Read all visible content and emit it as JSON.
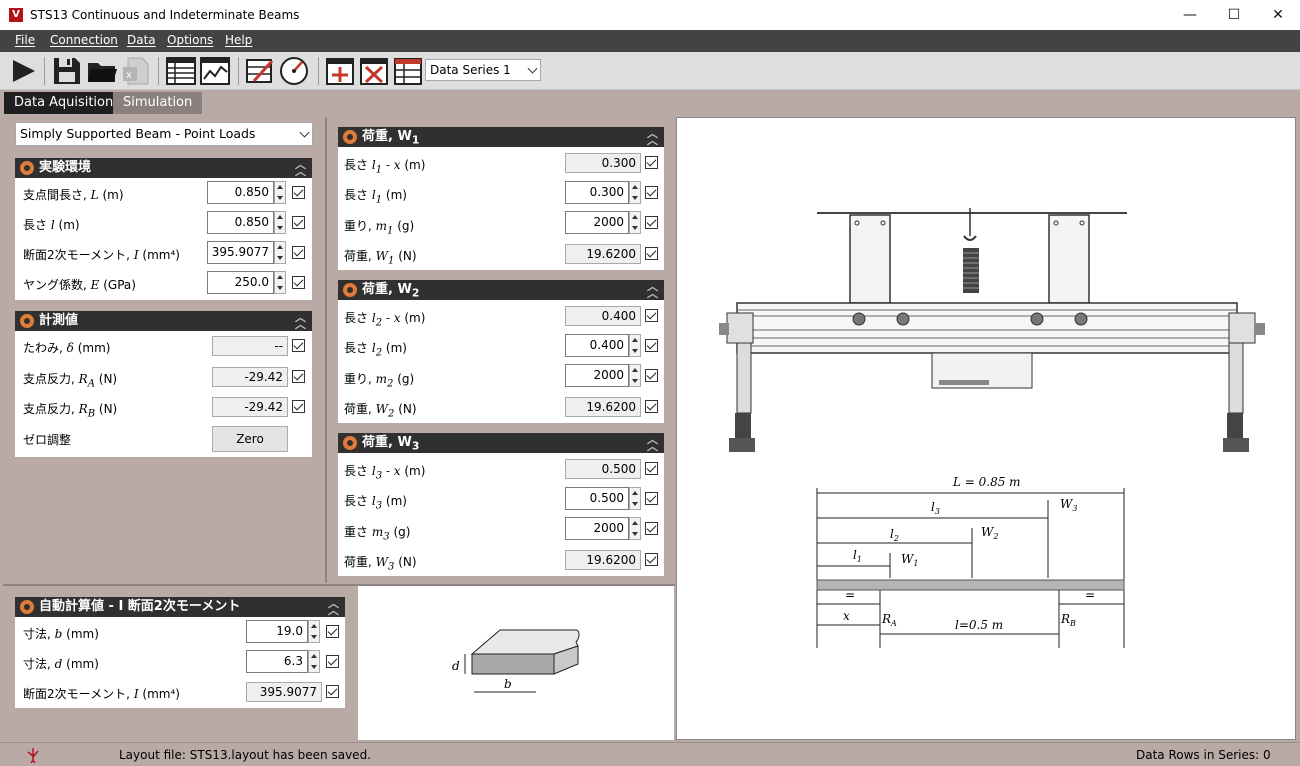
{
  "app": {
    "title": "STS13 Continuous and Indeterminate Beams",
    "logo_letter": "V",
    "window_buttons": {
      "minimize": "—",
      "maximize": "☐",
      "close": "✕"
    }
  },
  "menu": [
    "File",
    "Connection",
    "Data",
    "Options",
    "Help"
  ],
  "toolbar": {
    "series_value": "Data Series 1"
  },
  "tabs": [
    {
      "label": "Data Aquisition",
      "active": true
    },
    {
      "label": "Simulation",
      "active": false
    }
  ],
  "experiment_select": "Simply Supported Beam - Point Loads",
  "env_panel": {
    "title": "実験環境",
    "rows": [
      {
        "label": "支点間長さ,",
        "sym": "L",
        "unit": "(m)",
        "value": "0.850"
      },
      {
        "label": "長さ",
        "sym": "l",
        "unit": "(m)",
        "value": "0.850"
      },
      {
        "label": "断面2次モーメント,",
        "sym": "I",
        "unit": "(mm⁴)",
        "value": "395.9077"
      },
      {
        "label": "ヤング係数,",
        "sym": "E",
        "unit": "(GPa)",
        "value": "250.0"
      }
    ]
  },
  "meas_panel": {
    "title": "計測値",
    "rows": [
      {
        "label": "たわみ,",
        "sym": "δ",
        "unit": "(mm)",
        "value": "--"
      },
      {
        "label": "支点反力,",
        "sym": "R",
        "sub": "A",
        "unit": "(N)",
        "value": "-29.42"
      },
      {
        "label": "支点反力,",
        "sym": "R",
        "sub": "B",
        "unit": "(N)",
        "value": "-29.42"
      }
    ],
    "zero_label": "ゼロ調整",
    "zero_button": "Zero"
  },
  "w1_panel": {
    "title": "荷重, W",
    "title_sub": "1",
    "rows": [
      {
        "label": "長さ",
        "sym": "l",
        "sub": "1",
        "extra": " - x",
        "unit": "(m)",
        "value": "0.300",
        "editable": false
      },
      {
        "label": "長さ",
        "sym": "l",
        "sub": "1",
        "extra": "",
        "unit": "(m)",
        "value": "0.300",
        "editable": true
      },
      {
        "label": "重り,",
        "sym": "m",
        "sub": "1",
        "extra": "",
        "unit": "(g)",
        "value": "2000",
        "editable": true
      },
      {
        "label": "荷重,",
        "sym": "W",
        "sub": "1",
        "extra": "",
        "unit": "(N)",
        "value": "19.6200",
        "editable": false
      }
    ]
  },
  "w2_panel": {
    "title": "荷重, W",
    "title_sub": "2",
    "rows": [
      {
        "label": "長さ",
        "sym": "l",
        "sub": "2",
        "extra": " - x",
        "unit": "(m)",
        "value": "0.400",
        "editable": false
      },
      {
        "label": "長さ",
        "sym": "l",
        "sub": "2",
        "extra": "",
        "unit": "(m)",
        "value": "0.400",
        "editable": true
      },
      {
        "label": "重り,",
        "sym": "m",
        "sub": "2",
        "extra": "",
        "unit": "(g)",
        "value": "2000",
        "editable": true
      },
      {
        "label": "荷重,",
        "sym": "W",
        "sub": "2",
        "extra": "",
        "unit": "(N)",
        "value": "19.6200",
        "editable": false
      }
    ]
  },
  "w3_panel": {
    "title": "荷重, W",
    "title_sub": "3",
    "rows": [
      {
        "label": "長さ",
        "sym": "l",
        "sub": "3",
        "extra": " - x",
        "unit": "(m)",
        "value": "0.500",
        "editable": false
      },
      {
        "label": "長さ",
        "sym": "l",
        "sub": "3",
        "extra": "",
        "unit": "(m)",
        "value": "0.500",
        "editable": true
      },
      {
        "label": "重さ",
        "sym": "m",
        "sub": "3",
        "extra": "",
        "unit": "(g)",
        "value": "2000",
        "editable": true
      },
      {
        "label": "荷重,",
        "sym": "W",
        "sub": "3",
        "extra": "",
        "unit": "(N)",
        "value": "19.6200",
        "editable": false
      }
    ]
  },
  "calc_panel": {
    "title": "自動計算値 - I 断面2次モーメント",
    "rows": [
      {
        "label": "寸法,",
        "sym": "b",
        "unit": "(mm)",
        "value": "19.0",
        "editable": true
      },
      {
        "label": "寸法,",
        "sym": "d",
        "unit": "(mm)",
        "value": "6.3",
        "editable": true
      },
      {
        "label": "断面2次モーメント,",
        "sym": "I",
        "unit": "(mm⁴)",
        "value": "395.9077",
        "editable": false
      }
    ],
    "section_labels": {
      "d": "d",
      "b": "b"
    }
  },
  "diagram": {
    "L_label": "L = 0.85 m",
    "l1": "l",
    "l1_sub": "1",
    "l2": "l",
    "l2_sub": "2",
    "l3": "l",
    "l3_sub": "3",
    "W1": "W",
    "W1_sub": "1",
    "W2": "W",
    "W2_sub": "2",
    "W3": "W",
    "W3_sub": "3",
    "RA": "R",
    "RA_sub": "A",
    "RB": "R",
    "RB_sub": "B",
    "x_label": "x",
    "span_label": "l=0.5 m",
    "eq": "="
  },
  "status": {
    "message": "Layout file: STS13.layout has been saved.",
    "rows": "Data Rows in Series: 0"
  }
}
